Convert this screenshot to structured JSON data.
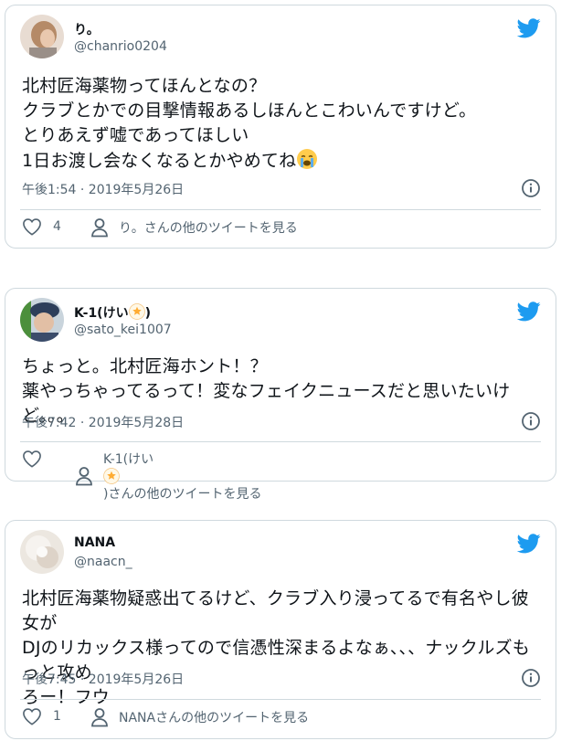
{
  "colors": {
    "twitter_blue": "#1d9bf0",
    "muted": "#536471",
    "border": "#cfd9de"
  },
  "tweets": [
    {
      "name": "り。",
      "handle": "@chanrio0204",
      "lines": [
        "北村匠海薬物ってほんとなの？",
        "クラブとかでの目撃情報あるしほんとこわいんですけど。",
        "とりあえず嘘であってほしい",
        "1日お渡し会なくなるとかやめてね"
      ],
      "timestamp": "午後1:54 · 2019年5月26日",
      "likes": "4",
      "more_link": "り。さんの他のツイートを見る",
      "emoji": "crying-face"
    },
    {
      "name_prefix": "K-1(けい",
      "name_suffix": ")",
      "handle": "@sato_kei1007",
      "lines": [
        "ちょっと。北村匠海ホント！？",
        "薬やっちゃってるって！変なフェイクニュースだと思いたいけど。。。"
      ],
      "timestamp": "午後7:42 · 2019年5月28日",
      "likes": "",
      "more_prefix": "K-1(けい",
      "more_suffix": ")さんの他のツイートを見る",
      "emoji": "dizzy-star"
    },
    {
      "name": "NANA",
      "handle": "@naacn_",
      "lines": [
        "北村匠海薬物疑惑出てるけど、クラブ入り浸ってるで有名やし彼女が",
        "DJのリカックス様ってので信憑性深まるよなぁ、、、ナックルズもっと攻め",
        "ろー！フウ"
      ],
      "timestamp": "午後7:45 · 2019年5月26日",
      "likes": "1",
      "more_link": "NANAさんの他のツイートを見る"
    }
  ]
}
